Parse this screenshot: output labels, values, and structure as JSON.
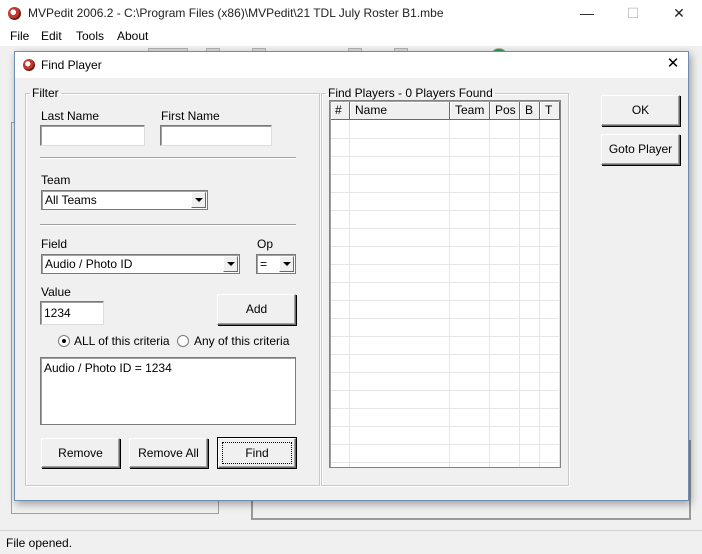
{
  "app": {
    "title": "MVPedit 2006.2 - C:\\Program Files (x86)\\MVPedit\\21 TDL July Roster B1.mbe",
    "minimize_glyph": "—",
    "maximize_glyph": "☐",
    "close_glyph": "✕"
  },
  "menu": {
    "file": "File",
    "edit": "Edit",
    "tools": "Tools",
    "about": "About"
  },
  "status": {
    "text": "File opened."
  },
  "dialog": {
    "title": "Find Player",
    "close_glyph": "✕",
    "filter": {
      "legend": "Filter",
      "last_name_label": "Last Name",
      "last_name_value": "",
      "first_name_label": "First Name",
      "first_name_value": "",
      "team_label": "Team",
      "team_value": "All Teams",
      "field_label": "Field",
      "field_value": "Audio / Photo ID",
      "op_label": "Op",
      "op_value": "=",
      "value_label": "Value",
      "value_value": "1234",
      "add_button": "Add",
      "radio_all_label": "ALL of this criteria",
      "radio_any_label": "Any of this criteria",
      "radio_selected": "all",
      "criteria": [
        "Audio / Photo ID = 1234"
      ],
      "remove_button": "Remove",
      "remove_all_button": "Remove All",
      "find_button": "Find"
    },
    "results": {
      "legend": "Find Players - 0 Players Found",
      "columns": [
        "#",
        "Name",
        "Team",
        "Pos",
        "B",
        "T"
      ],
      "rows": []
    },
    "ok_button": "OK",
    "goto_button": "Goto Player"
  },
  "icons": {
    "app": "mvpedit-app-icon"
  }
}
